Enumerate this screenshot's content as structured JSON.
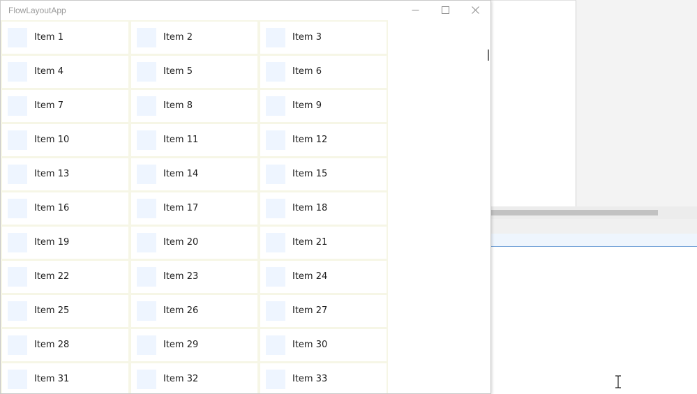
{
  "window": {
    "title": "FlowLayoutApp"
  },
  "caption_buttons": {
    "minimize_icon": "minimize-icon",
    "maximize_icon": "maximize-icon",
    "close_icon": "close-icon"
  },
  "items": [
    {
      "label": "Item 1"
    },
    {
      "label": "Item 2"
    },
    {
      "label": "Item 3"
    },
    {
      "label": "Item 4"
    },
    {
      "label": "Item 5"
    },
    {
      "label": "Item 6"
    },
    {
      "label": "Item 7"
    },
    {
      "label": "Item 8"
    },
    {
      "label": "Item 9"
    },
    {
      "label": "Item 10"
    },
    {
      "label": "Item 11"
    },
    {
      "label": "Item 12"
    },
    {
      "label": "Item 13"
    },
    {
      "label": "Item 14"
    },
    {
      "label": "Item 15"
    },
    {
      "label": "Item 16"
    },
    {
      "label": "Item 17"
    },
    {
      "label": "Item 18"
    },
    {
      "label": "Item 19"
    },
    {
      "label": "Item 20"
    },
    {
      "label": "Item 21"
    },
    {
      "label": "Item 22"
    },
    {
      "label": "Item 23"
    },
    {
      "label": "Item 24"
    },
    {
      "label": "Item 25"
    },
    {
      "label": "Item 26"
    },
    {
      "label": "Item 27"
    },
    {
      "label": "Item 28"
    },
    {
      "label": "Item 29"
    },
    {
      "label": "Item 30"
    },
    {
      "label": "Item 31"
    },
    {
      "label": "Item 32"
    },
    {
      "label": "Item 33"
    }
  ],
  "colors": {
    "cell_border": "#f6f6e6",
    "thumbnail": "#eef5ff",
    "title_text": "#9a9a9a",
    "selection_underline": "#7aa7d9"
  }
}
